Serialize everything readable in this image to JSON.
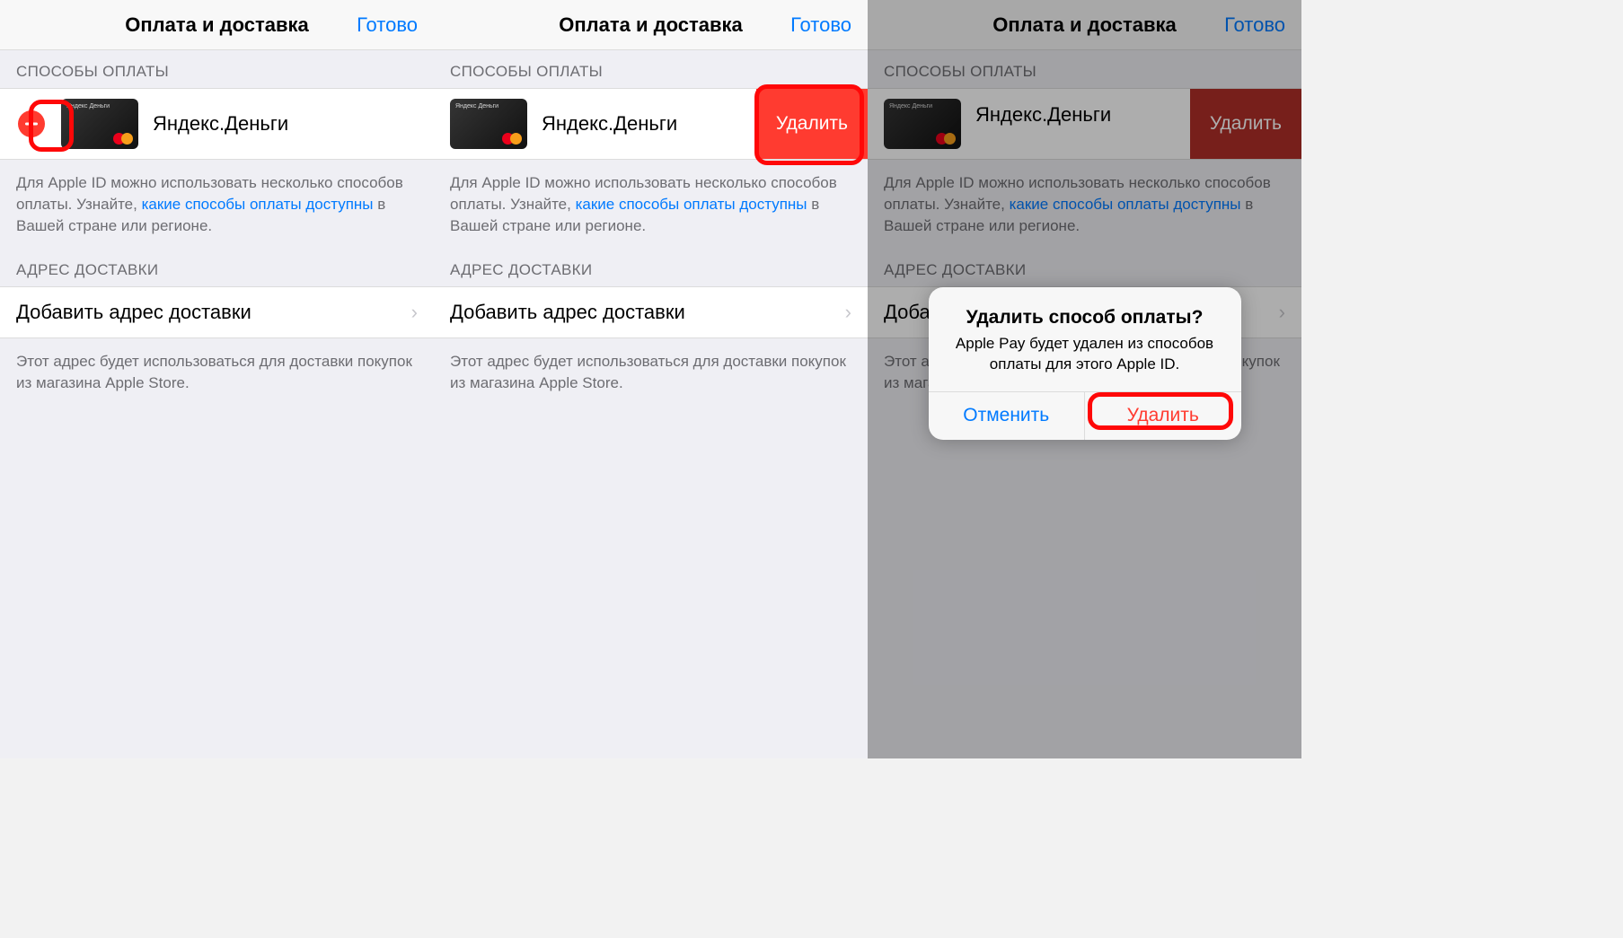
{
  "nav": {
    "title": "Оплата и доставка",
    "done": "Готово"
  },
  "payment": {
    "header": "СПОСОБЫ ОПЛАТЫ",
    "card_label": "Яндекс.Деньги",
    "card_brand": "Яндекс Деньги",
    "delete_label": "Удалить",
    "note_prefix": "Для Apple ID можно использовать несколько способов оплаты. Узнайте, ",
    "note_link": "какие способы оплаты доступны",
    "note_suffix": " в Вашей стране или регионе."
  },
  "shipping": {
    "header": "АДРЕС ДОСТАВКИ",
    "add_label": "Добавить адрес доставки",
    "note": "Этот адрес будет использоваться для доставки покупок из магазина Apple Store."
  },
  "alert": {
    "title": "Удалить способ оплаты?",
    "message": "Apple Pay будет удален из способов оплаты для этого Apple ID.",
    "cancel": "Отменить",
    "delete": "Удалить"
  }
}
